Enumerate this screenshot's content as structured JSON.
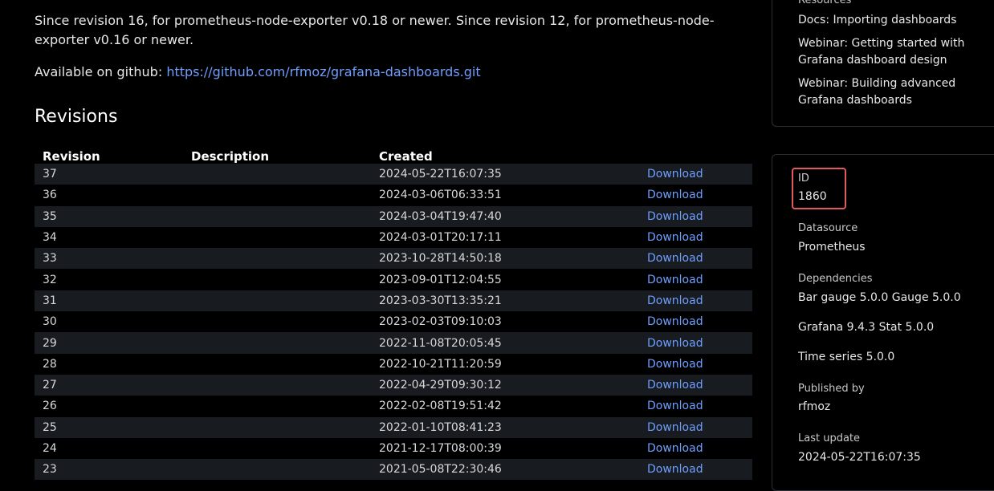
{
  "main": {
    "intro_text": "Since revision 16, for prometheus-node-exporter v0.18 or newer. Since revision 12, for prometheus-node-exporter v0.16 or newer.",
    "github_prefix": "Available on github: ",
    "github_link": "https://github.com/rfmoz/grafana-dashboards.git",
    "revisions_title": "Revisions",
    "table_headers": {
      "revision": "Revision",
      "description": "Description",
      "created": "Created",
      "download": ""
    },
    "revisions": [
      {
        "revision": "37",
        "description": "",
        "created": "2024-05-22T16:07:35",
        "download": "Download"
      },
      {
        "revision": "36",
        "description": "",
        "created": "2024-03-06T06:33:51",
        "download": "Download"
      },
      {
        "revision": "35",
        "description": "",
        "created": "2024-03-04T19:47:40",
        "download": "Download"
      },
      {
        "revision": "34",
        "description": "",
        "created": "2024-03-01T20:17:11",
        "download": "Download"
      },
      {
        "revision": "33",
        "description": "",
        "created": "2023-10-28T14:50:18",
        "download": "Download"
      },
      {
        "revision": "32",
        "description": "",
        "created": "2023-09-01T12:04:55",
        "download": "Download"
      },
      {
        "revision": "31",
        "description": "",
        "created": "2023-03-30T13:35:21",
        "download": "Download"
      },
      {
        "revision": "30",
        "description": "",
        "created": "2023-02-03T09:10:03",
        "download": "Download"
      },
      {
        "revision": "29",
        "description": "",
        "created": "2022-11-08T20:05:45",
        "download": "Download"
      },
      {
        "revision": "28",
        "description": "",
        "created": "2022-10-21T11:20:59",
        "download": "Download"
      },
      {
        "revision": "27",
        "description": "",
        "created": "2022-04-29T09:30:12",
        "download": "Download"
      },
      {
        "revision": "26",
        "description": "",
        "created": "2022-02-08T19:51:42",
        "download": "Download"
      },
      {
        "revision": "25",
        "description": "",
        "created": "2022-01-10T08:41:23",
        "download": "Download"
      },
      {
        "revision": "24",
        "description": "",
        "created": "2021-12-17T08:00:39",
        "download": "Download"
      },
      {
        "revision": "23",
        "description": "",
        "created": "2021-05-08T22:30:46",
        "download": "Download"
      }
    ]
  },
  "sidebar": {
    "resources": {
      "label": "Resources",
      "links": [
        "Docs: Importing dashboards",
        "Webinar: Getting started with Grafana dashboard design",
        "Webinar: Building advanced Grafana dashboards"
      ]
    },
    "info": {
      "id_label": "ID",
      "id_value": "1860",
      "datasource_label": "Datasource",
      "datasource_value": "Prometheus",
      "dependencies_label": "Dependencies",
      "dependencies": [
        "Bar gauge 5.0.0 Gauge 5.0.0",
        "Grafana 9.4.3 Stat 5.0.0",
        "Time series 5.0.0"
      ],
      "published_label": "Published by",
      "published_value": "rfmoz",
      "updated_label": "Last update",
      "updated_value": "2024-05-22T16:07:35"
    }
  },
  "colors": {
    "background": "#000000",
    "link": "#6e9fff",
    "row_stripe": "#181b1f",
    "highlight_box": "#e05a5f"
  }
}
